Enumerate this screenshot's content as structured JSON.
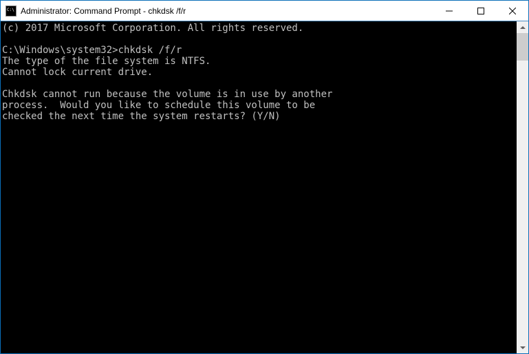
{
  "window": {
    "title": "Administrator: Command Prompt - chkdsk  /f/r"
  },
  "terminal": {
    "lines": [
      "(c) 2017 Microsoft Corporation. All rights reserved.",
      "",
      "C:\\Windows\\system32>chkdsk /f/r",
      "The type of the file system is NTFS.",
      "Cannot lock current drive.",
      "",
      "Chkdsk cannot run because the volume is in use by another",
      "process.  Would you like to schedule this volume to be",
      "checked the next time the system restarts? (Y/N)"
    ]
  }
}
